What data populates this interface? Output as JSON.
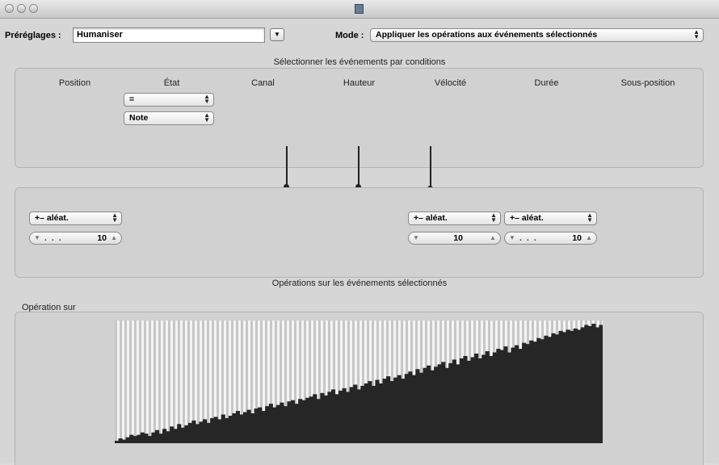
{
  "presets": {
    "label": "Préréglages :",
    "value": "Humaniser"
  },
  "mode": {
    "label": "Mode :",
    "value": "Appliquer les opérations aux événements sélectionnés"
  },
  "select_section": {
    "title": "Sélectionner les événements par conditions",
    "columns": [
      "Position",
      "État",
      "Canal",
      "Hauteur",
      "Vélocité",
      "Durée",
      "Sous-position"
    ],
    "state_condition": "=",
    "state_value": "Note"
  },
  "operations": {
    "position_op": "+– aléat.",
    "position_value": "10",
    "velocity_op": "+– aléat.",
    "velocity_value": "10",
    "duration_op": "+– aléat.",
    "duration_value": "10"
  },
  "ops_section": {
    "title": "Opérations sur les événements sélectionnés"
  },
  "graph": {
    "label": "Opération sur",
    "bar_color": "#262626",
    "background_color": "#f4f4f4",
    "stripe_color": "#c7c7c7",
    "values": [
      2,
      4,
      3,
      5,
      7,
      6,
      7,
      9,
      8,
      6,
      9,
      11,
      8,
      12,
      10,
      14,
      12,
      16,
      13,
      15,
      17,
      19,
      16,
      18,
      20,
      17,
      21,
      22,
      20,
      24,
      21,
      23,
      25,
      27,
      24,
      26,
      28,
      25,
      29,
      30,
      27,
      31,
      33,
      30,
      32,
      34,
      31,
      35,
      36,
      33,
      37,
      36,
      38,
      39,
      41,
      37,
      42,
      40,
      43,
      45,
      41,
      44,
      46,
      43,
      47,
      49,
      45,
      48,
      50,
      52,
      48,
      53,
      50,
      54,
      56,
      52,
      55,
      57,
      54,
      58,
      60,
      57,
      62,
      59,
      63,
      65,
      61,
      64,
      66,
      68,
      63,
      67,
      70,
      66,
      71,
      73,
      69,
      72,
      75,
      71,
      74,
      77,
      73,
      76,
      79,
      78,
      81,
      76,
      80,
      82,
      79,
      84,
      83,
      86,
      85,
      88,
      87,
      90,
      89,
      92,
      91,
      94,
      93,
      95,
      94,
      96,
      95,
      97,
      99,
      98,
      100,
      97,
      99
    ]
  }
}
